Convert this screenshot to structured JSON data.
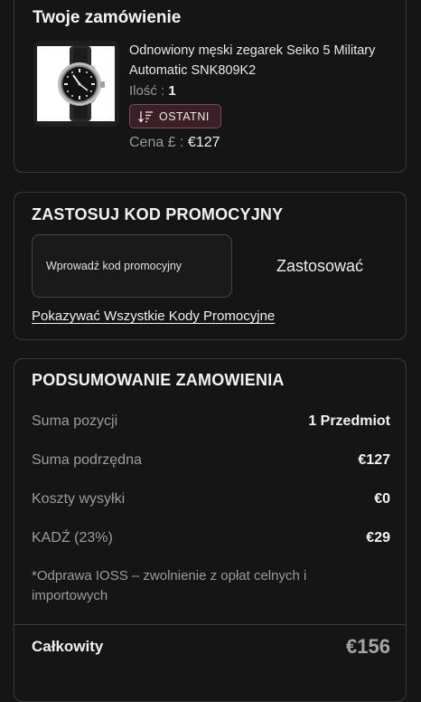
{
  "order": {
    "title": "Twoje zamówienie",
    "product_name": "Odnowiony męski zegarek Seiko 5 Military Automatic SNK809K2",
    "quantity_label": "Ilość :",
    "quantity_value": "1",
    "badge_label": "OSTATNI",
    "price_label": "Cena £ :",
    "price_value": "€127",
    "image_icon": "wristwatch"
  },
  "promo": {
    "title": "ZASTOSUJ KOD PROMOCYJNY",
    "input_placeholder": "Wprowadź kod promocyjny",
    "apply_label": "Zastosować",
    "show_all_link": "Pokazywać Wszystkie Kody Promocyjne"
  },
  "summary": {
    "title": "PODSUMOWANIE ZAMOWIENIA",
    "rows": [
      {
        "label": "Suma pozycji",
        "value": "1 Przedmiot"
      },
      {
        "label": "Suma podrzędna",
        "value": "€127"
      },
      {
        "label": "Koszty wysyłki",
        "value": "€0"
      },
      {
        "label": "KADŹ (23%)",
        "value": "€29"
      }
    ],
    "note": "*Odprawa IOSS – zwolnienie z opłat celnych i importowych",
    "total_label": "Całkowity",
    "total_value": "€156"
  },
  "colors": {
    "background": "#151515",
    "card_border": "#3a3a3a",
    "badge_bg": "#3b1f26",
    "badge_border": "#7a4a55",
    "muted_text": "#9c9c9c"
  }
}
